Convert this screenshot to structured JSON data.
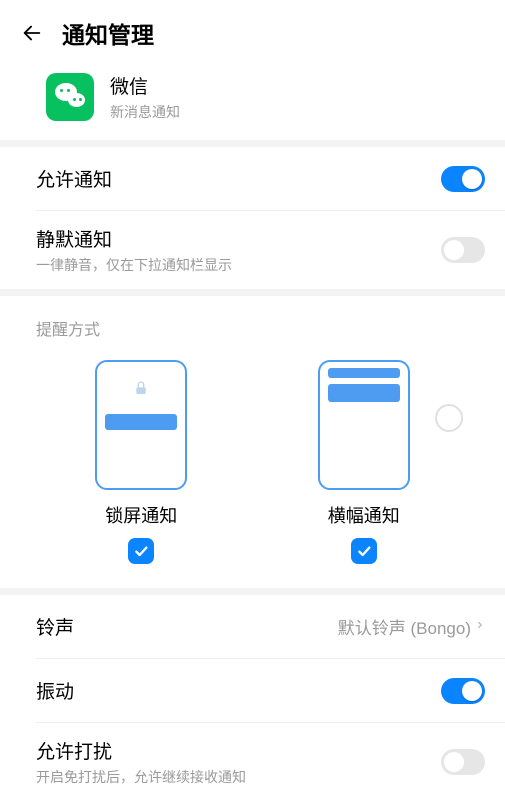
{
  "header": {
    "title": "通知管理"
  },
  "app": {
    "name": "微信",
    "subtitle": "新消息通知"
  },
  "allow_notifications": {
    "label": "允许通知",
    "on": true
  },
  "silent_notifications": {
    "label": "静默通知",
    "subtitle": "一律静音，仅在下拉通知栏显示",
    "on": false
  },
  "alert_style": {
    "section_title": "提醒方式",
    "lockscreen": {
      "label": "锁屏通知",
      "checked": true
    },
    "banner": {
      "label": "横幅通知",
      "checked": true
    }
  },
  "ringtone": {
    "label": "铃声",
    "value": "默认铃声 (Bongo)"
  },
  "vibration": {
    "label": "振动",
    "on": true
  },
  "allow_disturb": {
    "label": "允许打扰",
    "subtitle": "开启免打扰后，允许继续接收通知",
    "on": false
  }
}
